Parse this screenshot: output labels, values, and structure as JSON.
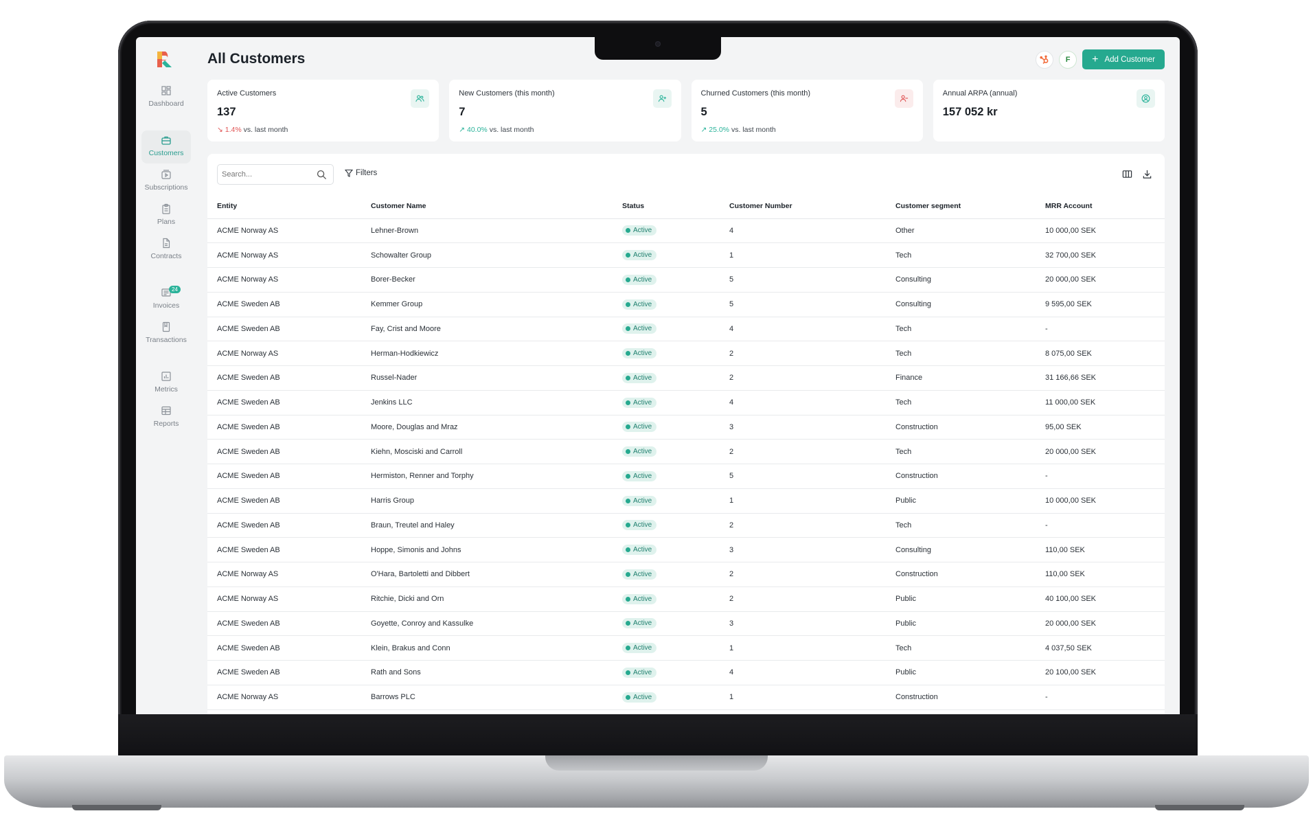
{
  "page": {
    "title": "All Customers"
  },
  "sidebar": {
    "items": [
      {
        "label": "Dashboard",
        "icon": "dashboard-icon"
      },
      {
        "label": "Customers",
        "icon": "briefcase-icon",
        "active": true
      },
      {
        "label": "Subscriptions",
        "icon": "subscriptions-icon"
      },
      {
        "label": "Plans",
        "icon": "clipboard-icon"
      },
      {
        "label": "Contracts",
        "icon": "document-icon"
      },
      {
        "label": "Invoices",
        "icon": "invoice-icon",
        "badge": "24"
      },
      {
        "label": "Transactions",
        "icon": "book-icon"
      },
      {
        "label": "Metrics",
        "icon": "bar-chart-icon"
      },
      {
        "label": "Reports",
        "icon": "table-icon"
      }
    ]
  },
  "header": {
    "integrations": [
      {
        "icon": "hubspot-icon"
      },
      {
        "icon": "fortnox-icon",
        "glyph": "F"
      }
    ],
    "add_button": "Add Customer"
  },
  "kpis": [
    {
      "title": "Active Customers",
      "value": "137",
      "delta": "1.4%",
      "delta_dir": "down",
      "suffix": "vs. last month",
      "icon": "users-icon"
    },
    {
      "title": "New Customers (this month)",
      "value": "7",
      "delta": "40.0%",
      "delta_dir": "up",
      "suffix": "vs. last month",
      "icon": "user-plus-icon"
    },
    {
      "title": "Churned Customers (this month)",
      "value": "5",
      "delta": "25.0%",
      "delta_dir": "up",
      "suffix": "vs. last month",
      "icon": "user-minus-icon"
    },
    {
      "title": "Annual ARPA (annual)",
      "value": "157 052 kr",
      "icon": "user-circle-icon"
    }
  ],
  "table": {
    "search_placeholder": "Search...",
    "filters_label": "Filters",
    "columns": [
      "Entity",
      "Customer Name",
      "Status",
      "Customer Number",
      "Customer segment",
      "MRR Account"
    ],
    "rows": [
      [
        "ACME Norway AS",
        "Lehner-Brown",
        "Active",
        "4",
        "Other",
        "10 000,00 SEK"
      ],
      [
        "ACME Norway AS",
        "Schowalter Group",
        "Active",
        "1",
        "Tech",
        "32 700,00 SEK"
      ],
      [
        "ACME Norway AS",
        "Borer-Becker",
        "Active",
        "5",
        "Consulting",
        "20 000,00 SEK"
      ],
      [
        "ACME Sweden AB",
        "Kemmer Group",
        "Active",
        "5",
        "Consulting",
        "9 595,00 SEK"
      ],
      [
        "ACME Sweden AB",
        "Fay, Crist and Moore",
        "Active",
        "4",
        "Tech",
        "-"
      ],
      [
        "ACME Norway AS",
        "Herman-Hodkiewicz",
        "Active",
        "2",
        "Tech",
        "8 075,00 SEK"
      ],
      [
        "ACME Sweden AB",
        "Russel-Nader",
        "Active",
        "2",
        "Finance",
        "31 166,66 SEK"
      ],
      [
        "ACME Sweden AB",
        "Jenkins LLC",
        "Active",
        "4",
        "Tech",
        "11 000,00 SEK"
      ],
      [
        "ACME Sweden AB",
        "Moore, Douglas and Mraz",
        "Active",
        "3",
        "Construction",
        "95,00 SEK"
      ],
      [
        "ACME Sweden AB",
        "Kiehn, Mosciski and Carroll",
        "Active",
        "2",
        "Tech",
        "20 000,00 SEK"
      ],
      [
        "ACME Sweden AB",
        "Hermiston, Renner and Torphy",
        "Active",
        "5",
        "Construction",
        "-"
      ],
      [
        "ACME Sweden AB",
        "Harris Group",
        "Active",
        "1",
        "Public",
        "10 000,00 SEK"
      ],
      [
        "ACME Sweden AB",
        "Braun, Treutel and Haley",
        "Active",
        "2",
        "Tech",
        "-"
      ],
      [
        "ACME Sweden AB",
        "Hoppe, Simonis and Johns",
        "Active",
        "3",
        "Consulting",
        "110,00 SEK"
      ],
      [
        "ACME Norway AS",
        "O'Hara, Bartoletti and Dibbert",
        "Active",
        "2",
        "Construction",
        "110,00 SEK"
      ],
      [
        "ACME Norway AS",
        "Ritchie, Dicki and Orn",
        "Active",
        "2",
        "Public",
        "40 100,00 SEK"
      ],
      [
        "ACME Sweden AB",
        "Goyette, Conroy and Kassulke",
        "Active",
        "3",
        "Public",
        "20 000,00 SEK"
      ],
      [
        "ACME Sweden AB",
        "Klein, Brakus and Conn",
        "Active",
        "1",
        "Tech",
        "4 037,50 SEK"
      ],
      [
        "ACME Sweden AB",
        "Rath and Sons",
        "Active",
        "4",
        "Public",
        "20 100,00 SEK"
      ],
      [
        "ACME Norway AS",
        "Barrows PLC",
        "Active",
        "1",
        "Construction",
        "-"
      ]
    ]
  },
  "colors": {
    "accent": "#26a98f",
    "negative": "#e05454",
    "background": "#f3f4f5"
  }
}
